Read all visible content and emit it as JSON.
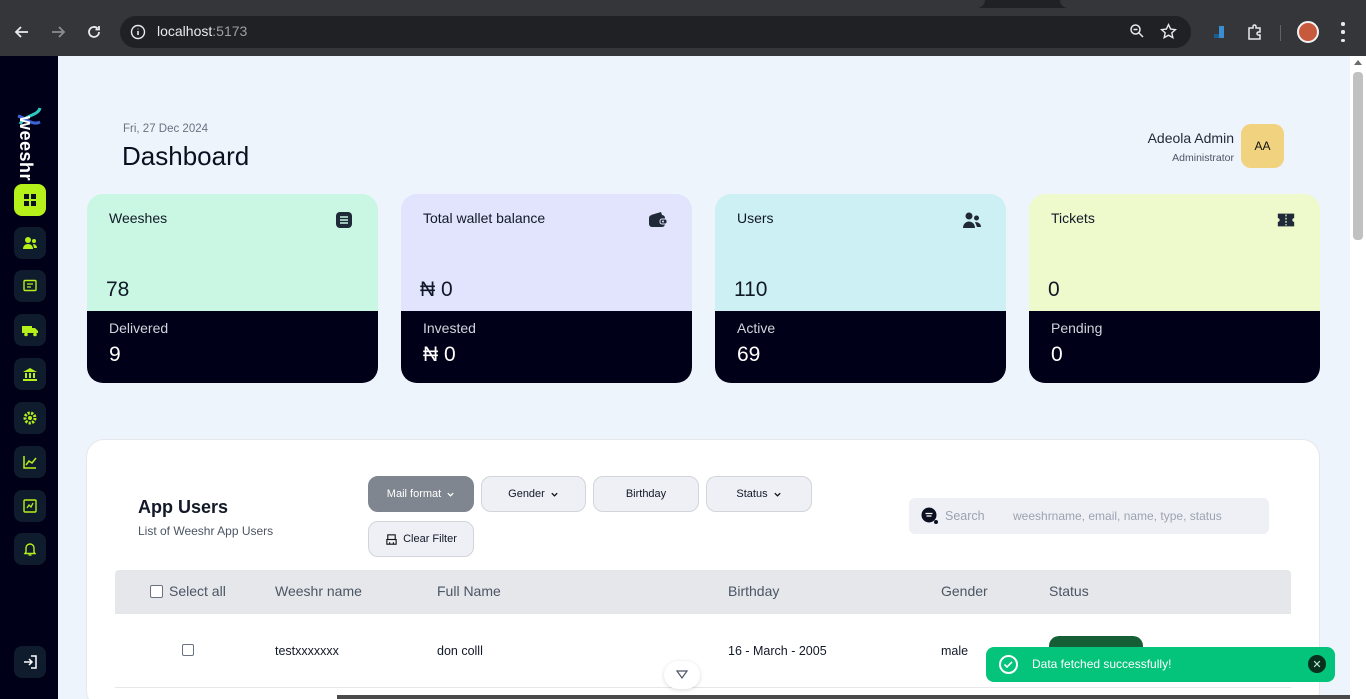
{
  "browser": {
    "url_host": "localhost",
    "url_port": ":5173"
  },
  "header": {
    "date": "Fri, 27 Dec 2024",
    "title": "Dashboard",
    "user_name": "Adeola Admin",
    "user_role": "Administrator",
    "avatar_initials": "AA"
  },
  "sidebar": {
    "logo_text": "weeshr",
    "items": [
      {
        "icon": "dashboard-icon",
        "active": true
      },
      {
        "icon": "users-icon"
      },
      {
        "icon": "messages-icon"
      },
      {
        "icon": "delivery-truck-icon"
      },
      {
        "icon": "bank-icon"
      },
      {
        "icon": "settings-icon"
      },
      {
        "icon": "analytics-icon"
      },
      {
        "icon": "reports-icon"
      },
      {
        "icon": "notifications-icon"
      }
    ],
    "logout_icon": "logout-icon"
  },
  "cards": [
    {
      "label": "Weeshes",
      "value": "78",
      "sublabel": "Delivered",
      "subvalue": "9",
      "color": "#c9f7e3",
      "icon": "list-icon"
    },
    {
      "label": "Total wallet balance",
      "value": "₦ 0",
      "sublabel": "Invested",
      "subvalue": "₦ 0",
      "color": "#e2e3fd",
      "icon": "wallet-icon"
    },
    {
      "label": "Users",
      "value": "110",
      "sublabel": "Active",
      "subvalue": "69",
      "color": "#cdf0f5",
      "icon": "users-icon"
    },
    {
      "label": "Tickets",
      "value": "0",
      "sublabel": "Pending",
      "subvalue": "0",
      "color": "#eef9cc",
      "icon": "ticket-icon"
    }
  ],
  "panel": {
    "title": "App Users",
    "subtitle": "List of Weeshr App Users",
    "filters": {
      "mail_format": "Mail format",
      "gender": "Gender",
      "birthday": "Birthday",
      "status": "Status",
      "clear": "Clear Filter"
    },
    "search": {
      "label": "Search",
      "placeholder": "weeshrname, email, name, type, status"
    },
    "columns": {
      "select_all": "Select all",
      "weeshr_name": "Weeshr name",
      "full_name": "Full Name",
      "birthday": "Birthday",
      "gender": "Gender",
      "status": "Status"
    },
    "rows": [
      {
        "weeshr_name": "testxxxxxxx",
        "full_name": "don colll",
        "birthday": "16 - March - 2005",
        "gender": "male"
      }
    ]
  },
  "toast": {
    "message": "Data fetched successfully!"
  },
  "colors": {
    "sidebar": "#000018",
    "accent": "#b6f01a",
    "toast": "#04c37a",
    "card_bottom": "#000018"
  }
}
